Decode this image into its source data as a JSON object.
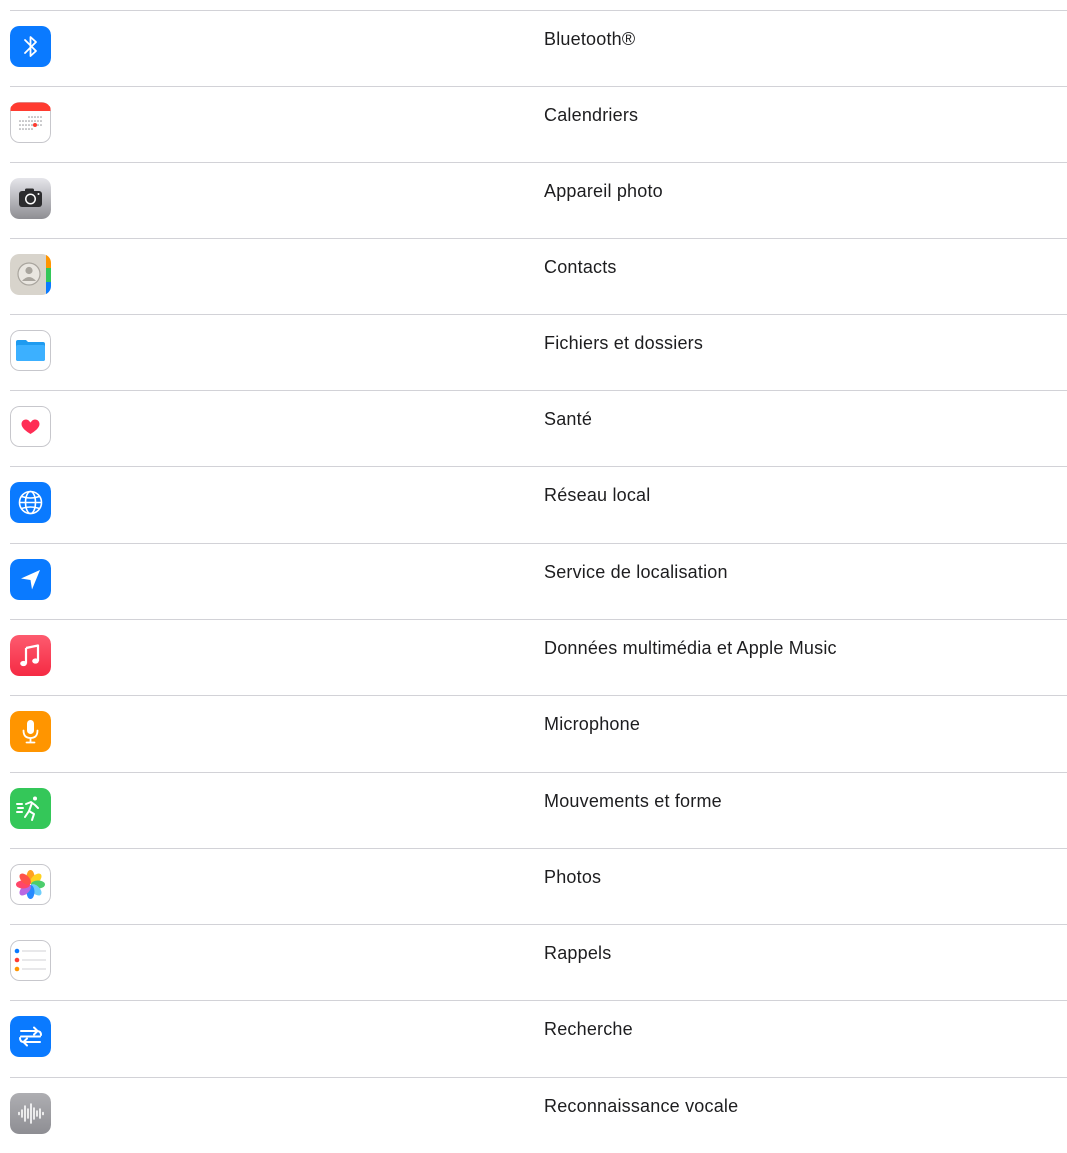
{
  "settings_list": {
    "items": [
      {
        "label": "Bluetooth®",
        "icon": "bluetooth-icon",
        "color": "#0a7aff"
      },
      {
        "label": "Calendriers",
        "icon": "calendar-icon",
        "color": "#ff3b30"
      },
      {
        "label": "Appareil photo",
        "icon": "camera-icon",
        "color": "#8e8e93"
      },
      {
        "label": "Contacts",
        "icon": "contacts-icon",
        "color": "#d8d4cc"
      },
      {
        "label": "Fichiers et dossiers",
        "icon": "folder-icon",
        "color": "#1e9bf0"
      },
      {
        "label": "Santé",
        "icon": "heart-icon",
        "color": "#ff2d55"
      },
      {
        "label": "Réseau local",
        "icon": "globe-icon",
        "color": "#0a7aff"
      },
      {
        "label": "Service de localisation",
        "icon": "location-arrow-icon",
        "color": "#0a7aff"
      },
      {
        "label": "Données multimédia et Apple Music",
        "icon": "music-note-icon",
        "color": "#fa2d48"
      },
      {
        "label": "Microphone",
        "icon": "microphone-icon",
        "color": "#ff9500"
      },
      {
        "label": "Mouvements et forme",
        "icon": "running-figure-icon",
        "color": "#34c759"
      },
      {
        "label": "Photos",
        "icon": "photos-flower-icon",
        "color": "#ffffff"
      },
      {
        "label": "Rappels",
        "icon": "reminders-list-icon",
        "color": "#ffffff"
      },
      {
        "label": "Recherche",
        "icon": "research-arrows-icon",
        "color": "#0a7aff"
      },
      {
        "label": "Reconnaissance vocale",
        "icon": "waveform-icon",
        "color": "#8e8e93"
      }
    ]
  }
}
